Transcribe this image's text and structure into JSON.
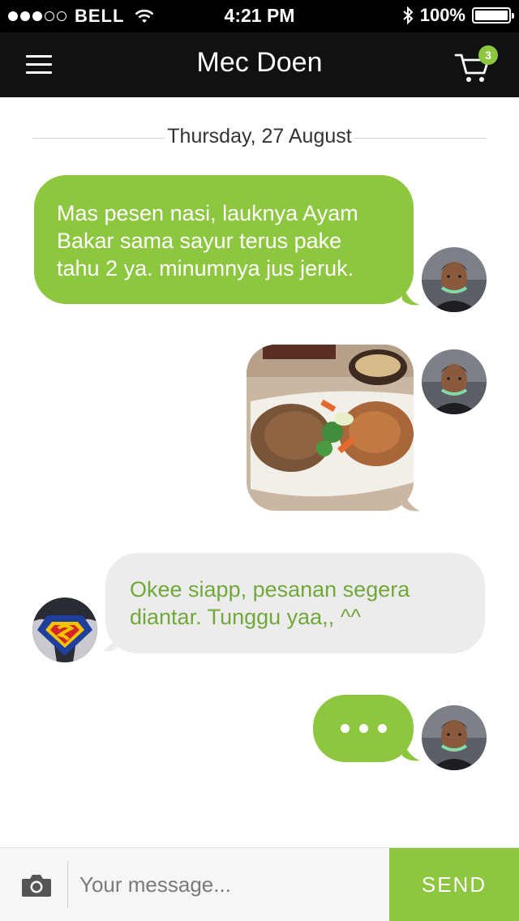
{
  "status_bar": {
    "carrier": "BELL",
    "signal_bars_filled": 3,
    "signal_bars_total": 5,
    "time": "4:21 PM",
    "battery": "100%",
    "battery_level": 1.0
  },
  "nav": {
    "title": "Mec Doen",
    "cart_count": "3",
    "accent_color": "#8dc63f"
  },
  "chat": {
    "date_label": "Thursday, 27 August",
    "messages": [
      {
        "sender": "me",
        "type": "text",
        "line1": "Mas pesen nasi, lauknya Ayam",
        "line2": "Bakar sama sayur terus pake",
        "line3": "tahu 2 ya. minumnya jus jeruk."
      },
      {
        "sender": "me",
        "type": "image",
        "image_subject": "food photo"
      },
      {
        "sender": "other",
        "type": "text",
        "line1": "Okee siapp, pesanan segera",
        "line2": "diantar. Tunggu yaa,, ^^"
      },
      {
        "sender": "me",
        "type": "typing"
      }
    ]
  },
  "composer": {
    "placeholder": "Your message...",
    "send_label": "SEND",
    "camera_icon": "camera-icon"
  }
}
